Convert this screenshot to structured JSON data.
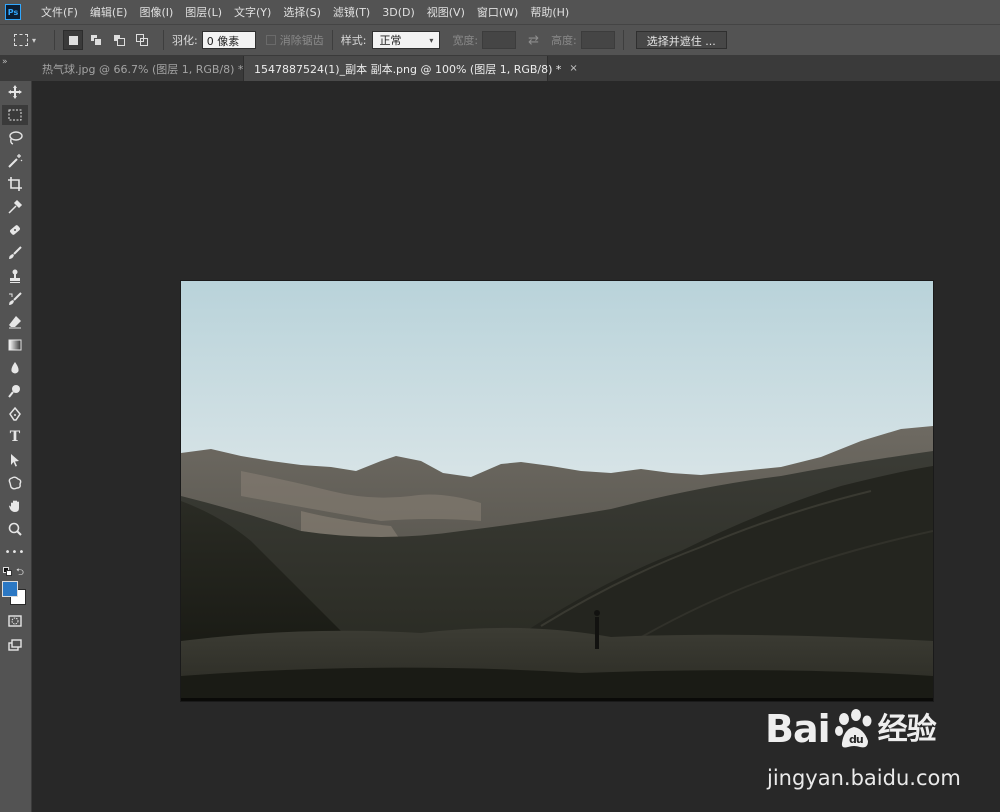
{
  "app": {
    "logo": "Ps"
  },
  "menu": [
    "文件(F)",
    "编辑(E)",
    "图像(I)",
    "图层(L)",
    "文字(Y)",
    "选择(S)",
    "滤镜(T)",
    "3D(D)",
    "视图(V)",
    "窗口(W)",
    "帮助(H)"
  ],
  "options": {
    "feather_label": "羽化:",
    "feather_value": "0 像素",
    "antialias_label": "消除锯齿",
    "style_label": "样式:",
    "style_value": "正常",
    "width_label": "宽度:",
    "height_label": "高度:",
    "refine_button": "选择并遮住 ..."
  },
  "tabs": [
    {
      "title": "热气球.jpg @ 66.7% (图层 1, RGB/8) *",
      "active": false
    },
    {
      "title": "1547887524(1)_副本 副本.png @ 100% (图层 1, RGB/8) *",
      "active": true
    }
  ],
  "tab_close_glyph": "×",
  "toolbar": {
    "tools": [
      "move-tool",
      "marquee-tool",
      "lasso-tool",
      "magic-wand-tool",
      "crop-tool",
      "eyedropper-tool",
      "healing-brush-tool",
      "brush-tool",
      "clone-stamp-tool",
      "history-brush-tool",
      "eraser-tool",
      "gradient-tool",
      "blur-tool",
      "dodge-tool",
      "pen-tool",
      "type-tool",
      "path-selection-tool",
      "shape-tool",
      "hand-tool",
      "zoom-tool",
      "more-tools"
    ],
    "more_label": "•••",
    "type_glyph": "T",
    "foreground_color": "#2b78c4",
    "background_color": "#ffffff"
  },
  "watermark": {
    "logo_left": "Bai",
    "logo_right": "经验",
    "url": "jingyan.baidu.com"
  }
}
